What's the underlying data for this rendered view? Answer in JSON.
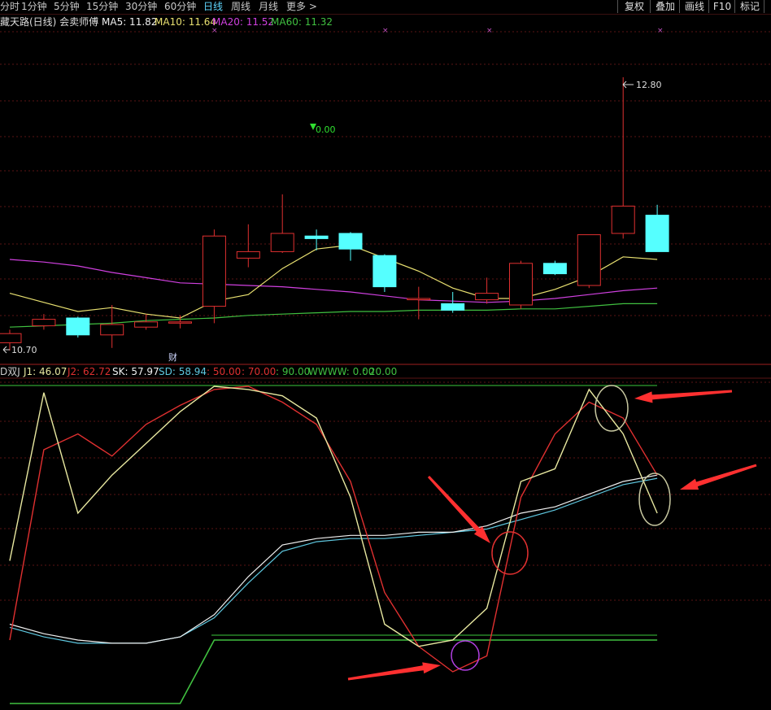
{
  "timeframes": [
    {
      "label": "分时",
      "active": false
    },
    {
      "label": "1分钟",
      "active": false
    },
    {
      "label": "5分钟",
      "active": false
    },
    {
      "label": "15分钟",
      "active": false
    },
    {
      "label": "30分钟",
      "active": false
    },
    {
      "label": "60分钟",
      "active": false
    },
    {
      "label": "日线",
      "active": true
    },
    {
      "label": "周线",
      "active": false
    },
    {
      "label": "月线",
      "active": false
    },
    {
      "label": "更多 >",
      "active": false
    }
  ],
  "toolbar": {
    "fuquan": "复权",
    "diejia": "叠加",
    "huaxian": "画线",
    "f10": "F10",
    "biaoji": "标记"
  },
  "main_info": {
    "title": "藏天路(日线) 会卖师傅",
    "ma5": "MA5: 11.82",
    "ma10": "MA10: 11.64",
    "ma20": "MA20: 11.52",
    "ma60": "MA60: 11.32"
  },
  "price_labels": {
    "high": "12.80",
    "low": "10.70",
    "marker": "0.00",
    "cai": "财"
  },
  "indicator_info": {
    "name": "D双J",
    "j1": "J1: 46.07",
    "j2": "J2: 62.72",
    "sk": "SK: 57.97",
    "sd": "SD: 58.94",
    "l50": ": 50.00",
    "l70": ": 70.00",
    "l90": ": 90.00",
    "wwww": "WWWW: 0.00",
    "l20": ": 20.00"
  },
  "colors": {
    "up": "#e03030",
    "down": "#55ffff",
    "ma5": "#f0f0f0",
    "ma10": "#e8e070",
    "ma20": "#d040e0",
    "ma60": "#40c040",
    "j1": "#e8e8a0",
    "j2": "#e03030",
    "sk": "#f0f0f0",
    "sd": "#5fc8e0",
    "wwww": "#40c040"
  },
  "candles": [
    {
      "o": 10.76,
      "h": 10.86,
      "l": 10.7,
      "c": 10.83
    },
    {
      "o": 10.89,
      "h": 10.98,
      "l": 10.86,
      "c": 10.94
    },
    {
      "o": 10.95,
      "h": 10.96,
      "l": 10.8,
      "c": 10.82
    },
    {
      "o": 10.82,
      "h": 11.05,
      "l": 10.72,
      "c": 10.9
    },
    {
      "o": 10.88,
      "h": 10.98,
      "l": 10.86,
      "c": 10.92
    },
    {
      "o": 10.92,
      "h": 10.97,
      "l": 10.87,
      "c": 10.92
    },
    {
      "o": 11.04,
      "h": 11.63,
      "l": 10.91,
      "c": 11.58
    },
    {
      "o": 11.41,
      "h": 11.67,
      "l": 11.34,
      "c": 11.46
    },
    {
      "o": 11.46,
      "h": 11.9,
      "l": 11.45,
      "c": 11.6
    },
    {
      "o": 11.58,
      "h": 11.63,
      "l": 11.47,
      "c": 11.56
    },
    {
      "o": 11.6,
      "h": 11.61,
      "l": 11.39,
      "c": 11.48
    },
    {
      "o": 11.43,
      "h": 11.44,
      "l": 11.15,
      "c": 11.19
    },
    {
      "o": 11.09,
      "h": 11.19,
      "l": 10.94,
      "c": 11.1
    },
    {
      "o": 11.06,
      "h": 11.15,
      "l": 10.99,
      "c": 11.01
    },
    {
      "o": 11.09,
      "h": 11.26,
      "l": 11.06,
      "c": 11.14
    },
    {
      "o": 11.05,
      "h": 11.39,
      "l": 11.02,
      "c": 11.37
    },
    {
      "o": 11.37,
      "h": 11.39,
      "l": 11.28,
      "c": 11.29
    },
    {
      "o": 11.2,
      "h": 11.59,
      "l": 11.18,
      "c": 11.59
    },
    {
      "o": 11.6,
      "h": 12.8,
      "l": 11.56,
      "c": 11.81
    },
    {
      "o": 11.74,
      "h": 11.82,
      "l": 11.69,
      "c": 11.46
    }
  ],
  "ma5": [
    11.14,
    11.07,
    11.0,
    11.03,
    10.98,
    10.95,
    11.08,
    11.13,
    11.33,
    11.48,
    11.51,
    11.41,
    11.31,
    11.18,
    11.1,
    11.1,
    11.17,
    11.27,
    11.42,
    11.4
  ],
  "ma20": [
    11.4,
    11.38,
    11.35,
    11.3,
    11.26,
    11.22,
    11.21,
    11.2,
    11.19,
    11.17,
    11.15,
    11.12,
    11.09,
    11.08,
    11.07,
    11.08,
    11.1,
    11.13,
    11.16,
    11.18
  ],
  "ma60": [
    10.88,
    10.89,
    10.9,
    10.91,
    10.93,
    10.94,
    10.95,
    10.97,
    10.98,
    10.99,
    11.0,
    11.0,
    11.01,
    11.01,
    11.01,
    11.02,
    11.02,
    11.04,
    11.06,
    11.06
  ],
  "ind_j1": [
    45,
    98,
    60,
    72,
    82,
    92,
    100,
    99,
    97,
    90,
    65,
    25,
    18,
    20,
    30,
    70,
    74,
    99,
    85,
    60
  ],
  "ind_j2": [
    20,
    80,
    85,
    78,
    88,
    94,
    99,
    100,
    95,
    88,
    70,
    35,
    18,
    10,
    15,
    65,
    85,
    95,
    90,
    72
  ],
  "ind_sk": [
    25,
    22,
    20,
    19,
    19,
    21,
    28,
    40,
    50,
    52,
    53,
    53,
    54,
    54,
    56,
    60,
    62,
    66,
    70,
    72
  ],
  "ind_sd": [
    24,
    21,
    19,
    19,
    19,
    21,
    27,
    38,
    48,
    51,
    52,
    52,
    53,
    54,
    55,
    58,
    61,
    65,
    69,
    71
  ],
  "ind_wwww": [
    0,
    0,
    0,
    0,
    0,
    0,
    20,
    20,
    20,
    20,
    20,
    20,
    20,
    20,
    20,
    20,
    20,
    20,
    20,
    20
  ]
}
